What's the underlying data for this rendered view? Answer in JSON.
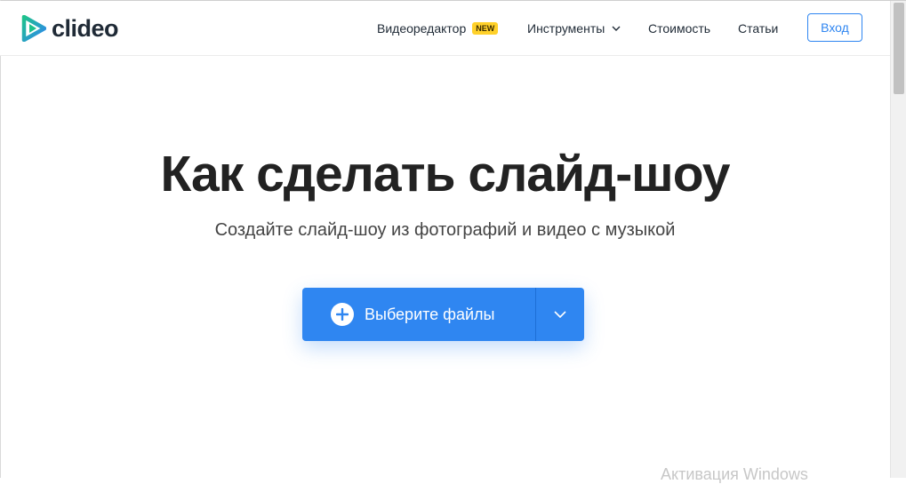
{
  "header": {
    "logo_text": "clideo",
    "nav": {
      "editor": "Видеоредактор",
      "editor_badge": "NEW",
      "tools": "Инструменты",
      "pricing": "Стоимость",
      "articles": "Статьи"
    },
    "login": "Вход"
  },
  "hero": {
    "title": "Как сделать слайд-шоу",
    "subtitle": "Создайте слайд-шоу из фотографий и видео с музыкой",
    "upload_label": "Выберите файлы"
  },
  "watermark": "Активация Windows",
  "colors": {
    "accent": "#2f86f1",
    "badge": "#ffd12a",
    "logo_green": "#1ec28b",
    "logo_blue": "#2f86f1"
  },
  "icons": {
    "logo": "play-triangle-logo-icon",
    "tools_chevron": "chevron-down-icon",
    "upload_plus": "plus-circle-icon",
    "upload_chevron": "chevron-down-icon"
  }
}
